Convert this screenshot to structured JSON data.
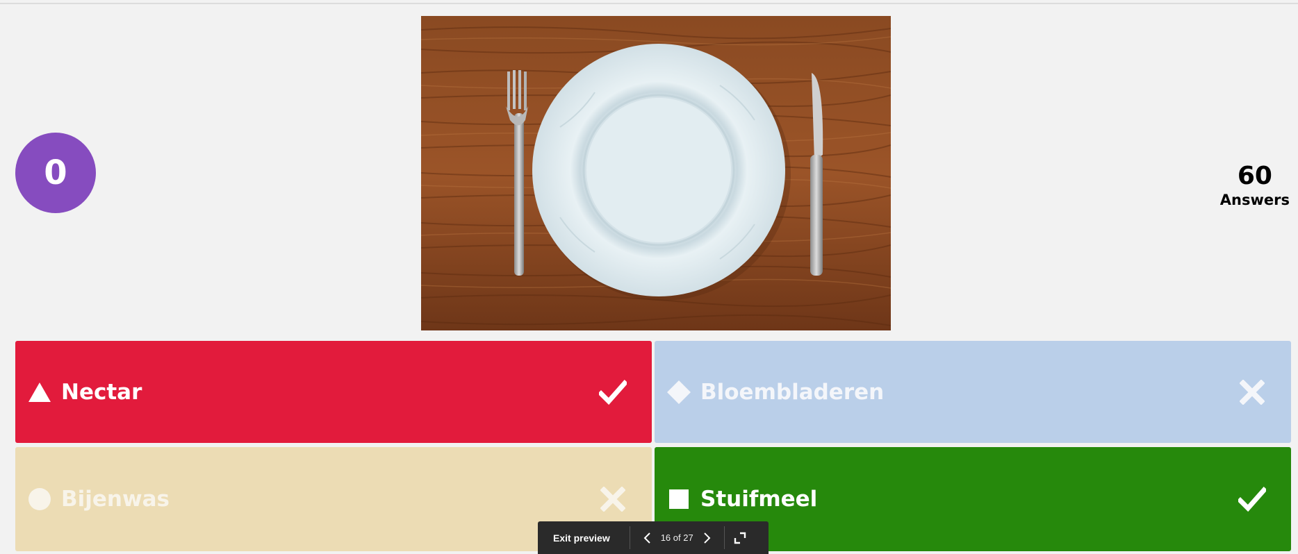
{
  "timer": {
    "value": "0"
  },
  "answers_count": {
    "value": "60",
    "label": "Answers"
  },
  "media": {
    "icon": "plate-with-fork-and-knife-image"
  },
  "options": [
    {
      "label": "Nectar",
      "shape": "triangle-icon",
      "result": "correct",
      "color": "#e21b3c",
      "text_color": "#ffffff"
    },
    {
      "label": "Bloembladeren",
      "shape": "diamond-icon",
      "result": "incorrect",
      "color": "#bacfe9",
      "text_color": "#f4f6fa"
    },
    {
      "label": "Bijenwas",
      "shape": "circle-icon",
      "result": "incorrect",
      "color": "#ecdcb4",
      "text_color": "#f8f4ea"
    },
    {
      "label": "Stuifmeel",
      "shape": "square-icon",
      "result": "correct",
      "color": "#26890c",
      "text_color": "#ffffff"
    }
  ],
  "preview_bar": {
    "exit_label": "Exit preview",
    "counter": "16 of 27"
  },
  "colors": {
    "background": "#f2f2f2",
    "timer": "#864cbf",
    "preview_bar": "#2a2a2a"
  }
}
